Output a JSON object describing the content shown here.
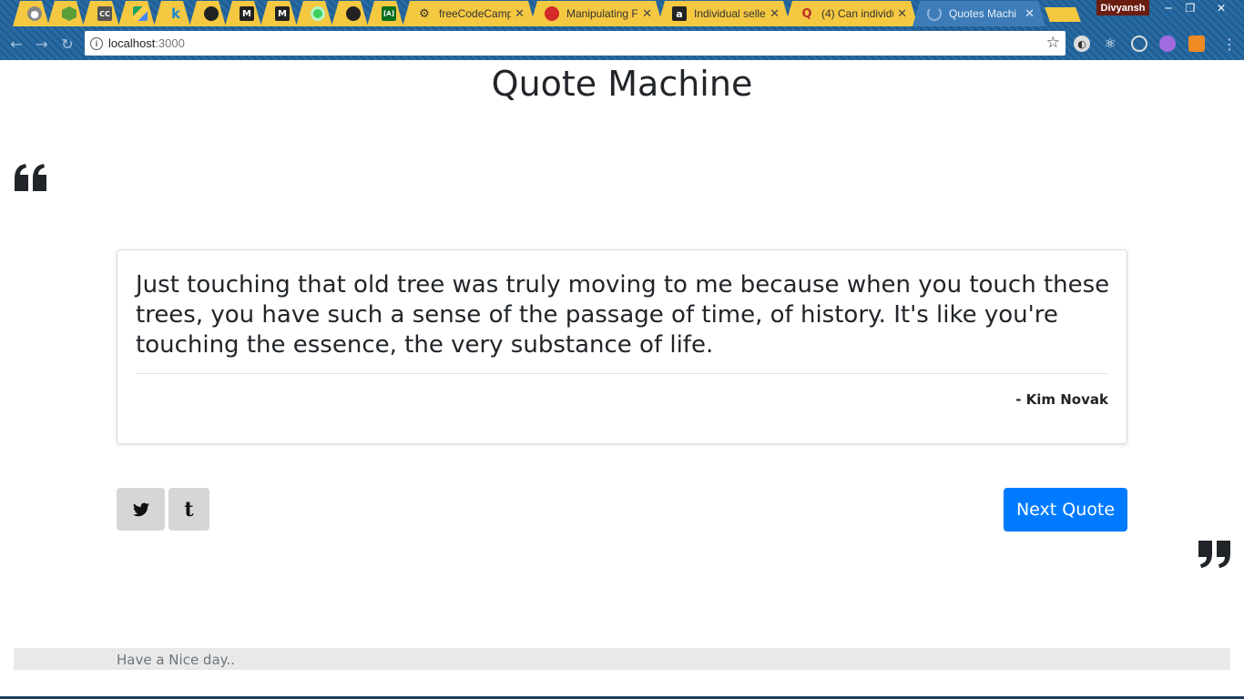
{
  "browser": {
    "tabs": [
      {
        "title": "",
        "icon": "generic-page-icon"
      },
      {
        "title": "",
        "icon": "nodejs-icon"
      },
      {
        "title": "",
        "icon": "cc-icon"
      },
      {
        "title": "",
        "icon": "drive-icon"
      },
      {
        "title": "",
        "icon": "k-icon"
      },
      {
        "title": "",
        "icon": "github-icon"
      },
      {
        "title": "",
        "icon": "medium-icon"
      },
      {
        "title": "",
        "icon": "medium-icon"
      },
      {
        "title": "",
        "icon": "circle-app-icon"
      },
      {
        "title": "",
        "icon": "github-icon"
      },
      {
        "title": "",
        "icon": "codeblock-icon"
      },
      {
        "title": "freeCodeCamp",
        "icon": "freecodecamp-icon"
      },
      {
        "title": "Manipulating F",
        "icon": "redhat-icon"
      },
      {
        "title": "Individual selle",
        "icon": "amazon-icon"
      },
      {
        "title": "(4) Can individu",
        "icon": "quora-icon"
      },
      {
        "title": "Quotes Machi",
        "icon": "loading-icon",
        "active": true
      }
    ],
    "profile_name": "Divyansh",
    "url_host": "localhost",
    "url_port": ":3000"
  },
  "page": {
    "title": "Quote Machine",
    "quote": {
      "text": "Just touching that old tree was truly moving to me because when you touch these trees, you have such a sense of the passage of time, of history. It's like you're touching the essence, the very substance of life.",
      "author": "- Kim Novak"
    },
    "next_button": "Next Quote",
    "footer": "Have a Nice day.."
  },
  "colors": {
    "primary": "#007bff",
    "share_button_bg": "#d6d6d6",
    "footer_bg": "#e9e9e9",
    "text": "#212529"
  }
}
